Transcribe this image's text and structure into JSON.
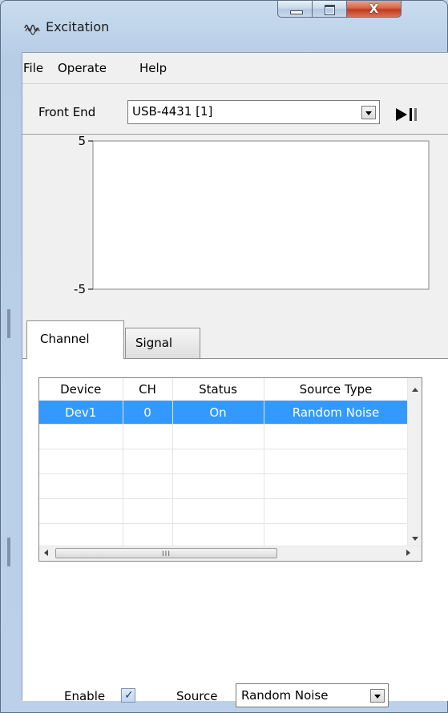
{
  "window": {
    "title": "Excitation",
    "app_icon": "sound-wave-icon",
    "controls": [
      "minimize",
      "maximize",
      "close"
    ],
    "close_glyph": "X"
  },
  "menu": {
    "items": [
      "File",
      "Operate",
      "Help"
    ]
  },
  "toolbar": {
    "front_end_label": "Front End",
    "front_end_value": "USB-4431 [1]",
    "run_icon": "play-pause-icon"
  },
  "chart": {
    "y_top_label": "5",
    "y_bottom_label": "-5"
  },
  "chart_data": {
    "type": "line",
    "ylim": [
      -5,
      5
    ],
    "series": [],
    "grid": false
  },
  "tabs": {
    "channel": "Channel",
    "signal": "Signal",
    "active": "Channel"
  },
  "table": {
    "columns": [
      "Device",
      "CH",
      "Status",
      "Source Type"
    ],
    "rows": [
      [
        "Dev1",
        "0",
        "On",
        "Random Noise"
      ]
    ],
    "selected_row": 0,
    "empty_rows": 5,
    "scroll_grip": "III"
  },
  "controls": {
    "enable_label": "Enable",
    "enable_checked": true,
    "source_label": "Source",
    "source_value": "Random Noise"
  },
  "colors": {
    "selection": "#3399ff",
    "close_button": "#c3391c",
    "frame": "#c4d6ea"
  }
}
